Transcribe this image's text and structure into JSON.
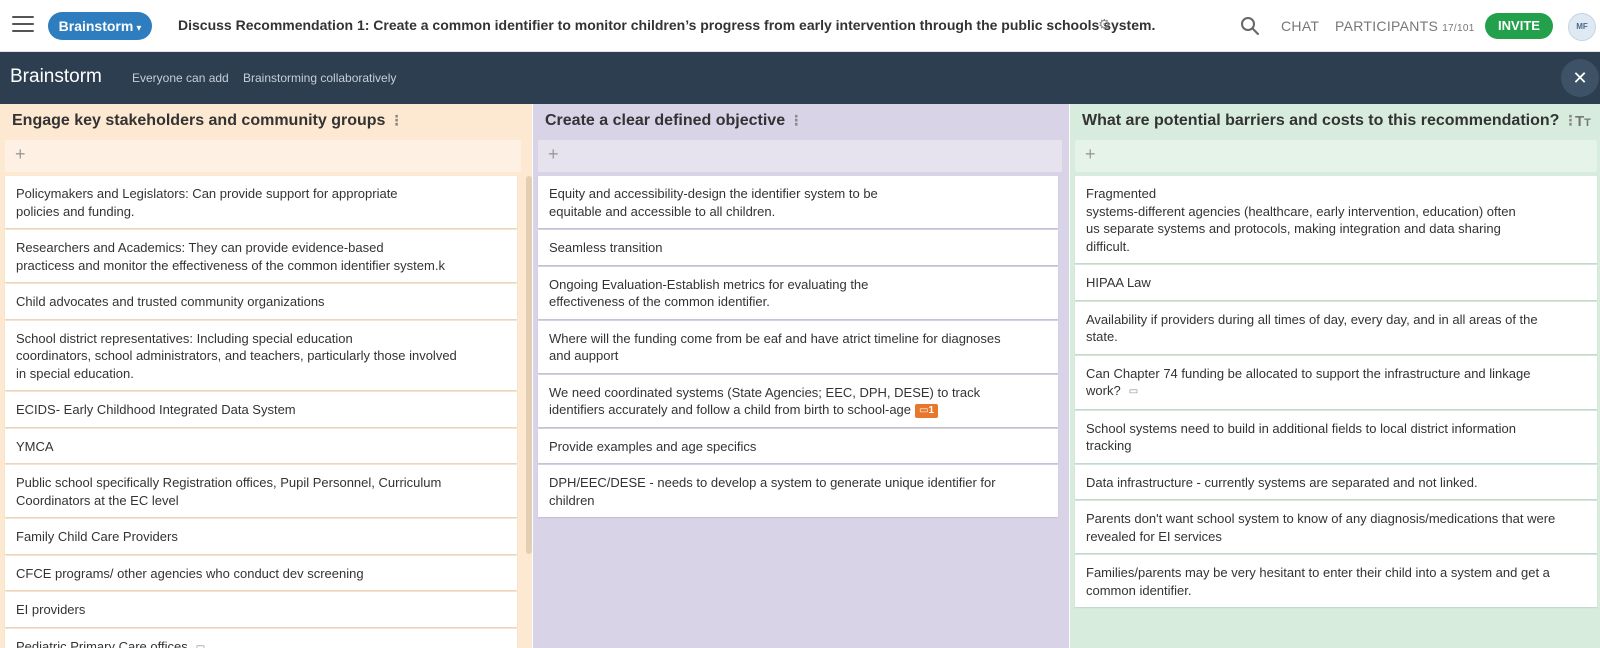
{
  "topbar": {
    "mode_label": "Brainstorm",
    "topic": "Discuss Recommendation 1: Create a common identifier to monitor children’s progress from early intervention through the public schools system.",
    "chat_label": "CHAT",
    "participants_label": "PARTICIPANTS",
    "participants_count": "17/101",
    "invite_label": "INVITE",
    "avatar_initials": "MF"
  },
  "subbar": {
    "title": "Brainstorm",
    "tag1": "Everyone can add",
    "tag2": "Brainstorming collaboratively"
  },
  "columns": [
    {
      "title": "Engage key stakeholders and community groups",
      "color": "#fde9d2",
      "cards": [
        {
          "text": "Policymakers and Legislators: Can provide support for appropriate\npolicies and funding."
        },
        {
          "text": "Researchers and Academics: They can provide evidence-based\npracticess and monitor the effectiveness of the common identifier system.k"
        },
        {
          "text": "Child advocates and trusted community organizations"
        },
        {
          "text": "School district representatives: Including special education\ncoordinators, school administrators, and teachers, particularly those involved\nin special education."
        },
        {
          "text": "ECIDS- Early Childhood Integrated Data System"
        },
        {
          "text": "YMCA"
        },
        {
          "text": "Public school specifically Registration offices, Pupil Personnel, Curriculum\nCoordinators at the EC level"
        },
        {
          "text": "Family Child Care Providers"
        },
        {
          "text": "CFCE programs/ other agencies who conduct dev screening"
        },
        {
          "text": "EI providers"
        },
        {
          "text": "Pediatric Primary Care offices"
        }
      ]
    },
    {
      "title": "Create a clear defined objective",
      "color": "#d8d3e6",
      "cards": [
        {
          "text": "Equity and accessibility-design the identifier system to be\nequitable and accessible to all children."
        },
        {
          "text": "Seamless transition"
        },
        {
          "text": "Ongoing Evaluation-Establish metrics for evaluating the\neffectiveness of the common identifier."
        },
        {
          "text": "Where will the funding come from be eaf and have atrict timeline for diagnoses\nand aupport"
        },
        {
          "text": "We need coordinated systems (State Agencies; EEC, DPH, DESE)  to track\nidentifiers accurately and follow a child from birth to school-age",
          "badge": "1"
        },
        {
          "text": "Provide examples and age specifics"
        },
        {
          "text": "DPH/EEC/DESE - needs to develop a system to generate unique identifier for\nchildren"
        }
      ]
    },
    {
      "title": "What are potential barriers and costs to this recommendation?",
      "color": "#d7ecdc",
      "cards": [
        {
          "text": "Fragmented\nsystems-different agencies (healthcare, early intervention, education) often\nus separate systems and protocols, making integration and data sharing\ndifficult."
        },
        {
          "text": "HIPAA Law"
        },
        {
          "text": "Availability if providers during all times of day, every day,  and in all areas of the\nstate."
        },
        {
          "text": "Can Chapter 74 funding be allocated to support the infrastructure and linkage\nwork?"
        },
        {
          "text": "School systems need to build in additional fields to local district information\ntracking"
        },
        {
          "text": "Data infrastructure - currently systems are separated and not linked."
        },
        {
          "text": "Parents don't want school system to know of any diagnosis/medications that were\nrevealed for EI services"
        },
        {
          "text": "Families/parents may be very hesitant to enter their child into a system and get a\ncommon identifier."
        }
      ]
    }
  ],
  "colors": {
    "brand_blue": "#2e7dbf",
    "invite_green": "#22a04b",
    "subbar_navy": "#2c3e50",
    "badge_orange": "#e6772b"
  }
}
